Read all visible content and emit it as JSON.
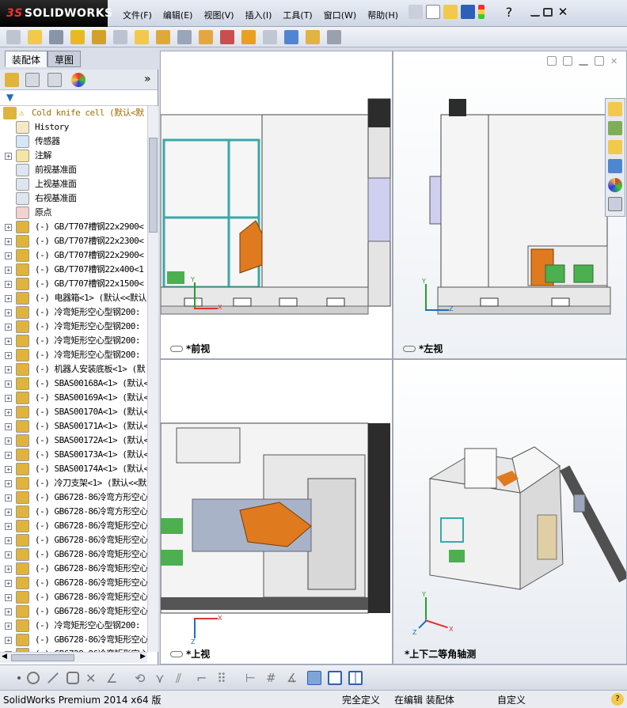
{
  "app": {
    "logo_text": "SOLIDWORKS",
    "logo_prefix": "3S"
  },
  "menu": [
    "文件(F)",
    "编辑(E)",
    "视图(V)",
    "插入(I)",
    "工具(T)",
    "窗口(W)",
    "帮助(H)"
  ],
  "left_tabs": {
    "assembly": "装配体",
    "sketch": "草图"
  },
  "tree": {
    "root": "Cold knife cell  (默认<默",
    "items": [
      {
        "label": "History",
        "expand": false
      },
      {
        "label": "传感器",
        "expand": false
      },
      {
        "label": "注解",
        "expand": true
      },
      {
        "label": "前视基准面",
        "expand": false
      },
      {
        "label": "上视基准面",
        "expand": false
      },
      {
        "label": "右视基准面",
        "expand": false
      },
      {
        "label": "原点",
        "expand": false
      },
      {
        "label": "(-) GB/T707槽钢22x2900<",
        "expand": true
      },
      {
        "label": "(-) GB/T707槽钢22x2300<",
        "expand": true
      },
      {
        "label": "(-) GB/T707槽钢22x2900<",
        "expand": true
      },
      {
        "label": "(-) GB/T707槽钢22x400<1",
        "expand": true
      },
      {
        "label": "(-) GB/T707槽钢22x1500<",
        "expand": true
      },
      {
        "label": "(-) 电器箱<1> (默认<<默认",
        "expand": true
      },
      {
        "label": "(-) 冷弯矩形空心型钢200:",
        "expand": true
      },
      {
        "label": "(-) 冷弯矩形空心型钢200:",
        "expand": true
      },
      {
        "label": "(-) 冷弯矩形空心型钢200:",
        "expand": true
      },
      {
        "label": "(-) 冷弯矩形空心型钢200:",
        "expand": true
      },
      {
        "label": "(-) 机器人安装底板<1> (默",
        "expand": true
      },
      {
        "label": "(-) SBAS00168A<1> (默认<",
        "expand": true
      },
      {
        "label": "(-) SBAS00169A<1> (默认<",
        "expand": true
      },
      {
        "label": "(-) SBAS00170A<1> (默认<",
        "expand": true
      },
      {
        "label": "(-) SBAS00171A<1> (默认<",
        "expand": true
      },
      {
        "label": "(-) SBAS00172A<1> (默认<",
        "expand": true
      },
      {
        "label": "(-) SBAS00173A<1> (默认<",
        "expand": true
      },
      {
        "label": "(-) SBAS00174A<1> (默认<",
        "expand": true
      },
      {
        "label": "(-) 冷刀支架<1> (默认<<默",
        "expand": true
      },
      {
        "label": "(-) GB6728-86冷弯方形空心",
        "expand": true
      },
      {
        "label": "(-) GB6728-86冷弯方形空心",
        "expand": true
      },
      {
        "label": "(-) GB6728-86冷弯矩形空心",
        "expand": true
      },
      {
        "label": "(-) GB6728-86冷弯矩形空心",
        "expand": true
      },
      {
        "label": "(-) GB6728-86冷弯矩形空心",
        "expand": true
      },
      {
        "label": "(-) GB6728-86冷弯矩形空心",
        "expand": true
      },
      {
        "label": "(-) GB6728-86冷弯矩形空心",
        "expand": true
      },
      {
        "label": "(-) GB6728-86冷弯矩形空心",
        "expand": true
      },
      {
        "label": "(-) GB6728-86冷弯矩形空心",
        "expand": true
      },
      {
        "label": "(-) 冷弯矩形空心型钢200:",
        "expand": true
      },
      {
        "label": "(-) GB6728-86冷弯矩形空心",
        "expand": true
      },
      {
        "label": "(-) GB6728-86冷弯矩形空心",
        "expand": true
      }
    ]
  },
  "views": {
    "front": "*前视",
    "left": "*左视",
    "top": "*上视",
    "iso": "*上下二等角轴测"
  },
  "axes": {
    "x": "X",
    "y": "Y",
    "z": "Z"
  },
  "status": {
    "product": "SolidWorks Premium 2014 x64 版",
    "defined": "完全定义",
    "editing": "在编辑 装配体",
    "custom": "自定义",
    "help": "?"
  },
  "colors": {
    "accent": "#1e6fb8",
    "robot": "#e07a1f",
    "frame": "#3aa8a8",
    "green": "#4caf50"
  }
}
